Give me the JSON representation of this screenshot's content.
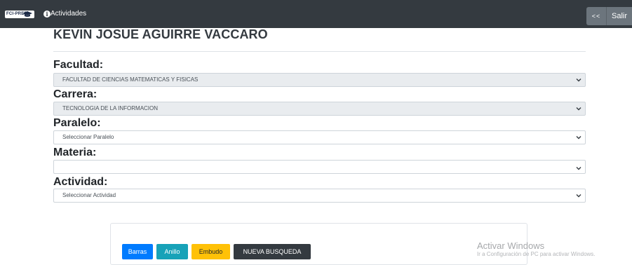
{
  "navbar": {
    "logo_text": "FCI-PRED",
    "activities_icon": "info-icon",
    "activities_label": "Actividades",
    "back_label": "<<",
    "logout_label": "Salir"
  },
  "user": {
    "name": "KEVIN JOSUE AGUIRRE VACCARO"
  },
  "form": {
    "facultad": {
      "label": "Facultad:",
      "value": "FACULTAD DE CIENCIAS MATEMATICAS Y FISICAS"
    },
    "carrera": {
      "label": "Carrera:",
      "value": "TECNOLOGIA DE LA INFORMACION"
    },
    "paralelo": {
      "label": "Paralelo:",
      "value": "Seleccionar Paralelo"
    },
    "materia": {
      "label": "Materia:",
      "value": ""
    },
    "actividad": {
      "label": "Actividad:",
      "value": "Seleccionar Actividad"
    }
  },
  "chart_buttons": {
    "barras": "Barras",
    "anillo": "Anillo",
    "embudo": "Embudo",
    "nueva_busqueda": "NUEVA BUSQUEDA"
  },
  "watermark": {
    "title": "Activar Windows",
    "subtitle": "Ir a Configuración de PC para activar Windows."
  },
  "colors": {
    "navbar": "#343a40",
    "primary": "#007bff",
    "info": "#17a2b8",
    "warning": "#ffc107",
    "secondary": "#6c757d"
  }
}
